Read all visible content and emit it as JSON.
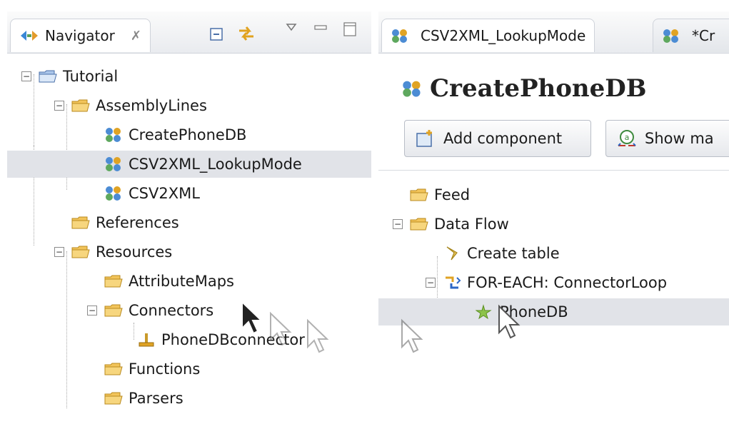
{
  "navigator": {
    "tab_label": "Navigator",
    "close_symbol": "✗",
    "toolbar": [
      "collapse-all-icon",
      "link-with-editor-icon",
      "view-menu-icon",
      "minimize-icon",
      "maximize-icon"
    ],
    "tree": [
      {
        "label": "Tutorial",
        "level": 0,
        "expander": "−",
        "icon": "project-folder-icon"
      },
      {
        "label": "AssemblyLines",
        "level": 1,
        "expander": "−",
        "icon": "folder-icon"
      },
      {
        "label": "CreatePhoneDB",
        "level": 2,
        "expander": "",
        "icon": "assembly-line-icon"
      },
      {
        "label": "CSV2XML_LookupMode",
        "level": 2,
        "expander": "",
        "icon": "assembly-line-icon",
        "selected": true
      },
      {
        "label": "CSV2XML",
        "level": 2,
        "expander": "",
        "icon": "assembly-line-icon"
      },
      {
        "label": "References",
        "level": 1,
        "expander": "",
        "icon": "folder-icon"
      },
      {
        "label": "Resources",
        "level": 1,
        "expander": "−",
        "icon": "folder-icon"
      },
      {
        "label": "AttributeMaps",
        "level": 2,
        "expander": "",
        "icon": "folder-icon"
      },
      {
        "label": "Connectors",
        "level": 2,
        "expander": "−",
        "icon": "folder-icon"
      },
      {
        "label": "PhoneDBconnector",
        "level": 3,
        "expander": "",
        "icon": "connector-icon"
      },
      {
        "label": "Functions",
        "level": 2,
        "expander": "",
        "icon": "folder-icon"
      },
      {
        "label": "Parsers",
        "level": 2,
        "expander": "",
        "icon": "folder-icon"
      }
    ]
  },
  "editor": {
    "tabs": [
      {
        "label": "CSV2XML_LookupMode"
      },
      {
        "label": "*Cr"
      }
    ],
    "title": "CreatePhoneDB",
    "buttons": {
      "add_component": "Add component",
      "show_mapping": "Show ma"
    },
    "tree": [
      {
        "label": "Feed",
        "level": 0,
        "expander": "",
        "icon": "folder-icon"
      },
      {
        "label": "Data Flow",
        "level": 0,
        "expander": "−",
        "icon": "folder-icon"
      },
      {
        "label": "Create table",
        "level": 1,
        "expander": "",
        "icon": "script-icon"
      },
      {
        "label": "FOR-EACH: ConnectorLoop",
        "level": 1,
        "expander": "−",
        "icon": "loop-icon"
      },
      {
        "label": "PhoneDB",
        "level": 2,
        "expander": "",
        "icon": "new-component-icon",
        "selected": true
      }
    ]
  },
  "colors": {
    "selection": "#e1e3e8",
    "folder": "#f2c45a",
    "tab_bg": "#e9ebef"
  }
}
